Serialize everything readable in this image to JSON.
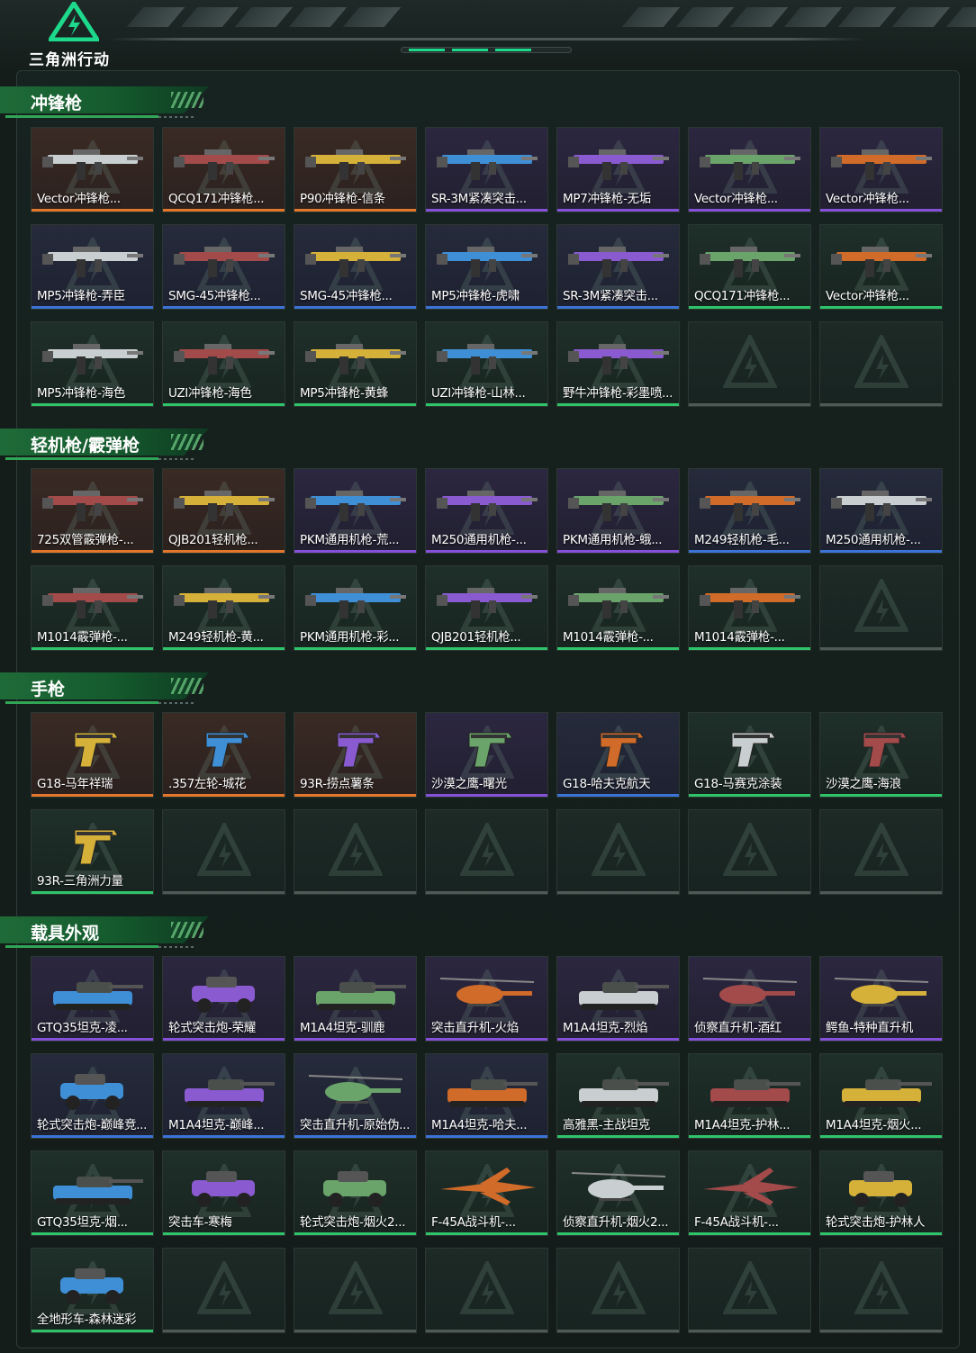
{
  "header": {
    "logo_text": "三角洲行动"
  },
  "colors": {
    "accent": "#1dd98c",
    "orange": "#e2772b",
    "purple": "#8551d8",
    "blue": "#3c73d6",
    "green": "#2fc46a"
  },
  "sections": [
    {
      "title": "冲锋枪",
      "icon": "smg",
      "items": [
        {
          "label": "Vector冲锋枪...",
          "rarity": "orange"
        },
        {
          "label": "QCQ171冲锋枪...",
          "rarity": "orange"
        },
        {
          "label": "P90冲锋枪-信条",
          "rarity": "orange"
        },
        {
          "label": "SR-3M紧凑突击...",
          "rarity": "purple"
        },
        {
          "label": "MP7冲锋枪-无垢",
          "rarity": "purple"
        },
        {
          "label": "Vector冲锋枪...",
          "rarity": "purple"
        },
        {
          "label": "Vector冲锋枪...",
          "rarity": "purple"
        },
        {
          "label": "MP5冲锋枪-弄臣",
          "rarity": "blue"
        },
        {
          "label": "SMG-45冲锋枪...",
          "rarity": "blue"
        },
        {
          "label": "SMG-45冲锋枪...",
          "rarity": "blue"
        },
        {
          "label": "MP5冲锋枪-虎啸",
          "rarity": "blue"
        },
        {
          "label": "SR-3M紧凑突击...",
          "rarity": "blue"
        },
        {
          "label": "QCQ171冲锋枪...",
          "rarity": "green"
        },
        {
          "label": "Vector冲锋枪...",
          "rarity": "green"
        },
        {
          "label": "MP5冲锋枪-海色",
          "rarity": "green"
        },
        {
          "label": "UZI冲锋枪-海色",
          "rarity": "green"
        },
        {
          "label": "MP5冲锋枪-黄蜂",
          "rarity": "green"
        },
        {
          "label": "UZI冲锋枪-山林...",
          "rarity": "green"
        },
        {
          "label": "野牛冲锋枪-彩墨喷...",
          "rarity": "green"
        },
        {
          "label": "",
          "rarity": "empty"
        },
        {
          "label": "",
          "rarity": "empty"
        }
      ]
    },
    {
      "title": "轻机枪/霰弹枪",
      "icon": "lmg",
      "items": [
        {
          "label": "725双管霰弹枪-...",
          "rarity": "orange"
        },
        {
          "label": "QJB201轻机枪...",
          "rarity": "orange"
        },
        {
          "label": "PKM通用机枪-荒...",
          "rarity": "purple"
        },
        {
          "label": "M250通用机枪-...",
          "rarity": "purple"
        },
        {
          "label": "PKM通用机枪-蛾...",
          "rarity": "purple"
        },
        {
          "label": "M249轻机枪-毛...",
          "rarity": "blue"
        },
        {
          "label": "M250通用机枪-...",
          "rarity": "blue"
        },
        {
          "label": "M1014霰弹枪-...",
          "rarity": "green"
        },
        {
          "label": "M249轻机枪-黄...",
          "rarity": "green"
        },
        {
          "label": "PKM通用机枪-彩...",
          "rarity": "green"
        },
        {
          "label": "QJB201轻机枪...",
          "rarity": "green"
        },
        {
          "label": "M1014霰弹枪-...",
          "rarity": "green"
        },
        {
          "label": "M1014霰弹枪-...",
          "rarity": "green"
        },
        {
          "label": "",
          "rarity": "empty"
        }
      ]
    },
    {
      "title": "手枪",
      "icon": "pistol",
      "items": [
        {
          "label": "G18-马年祥瑞",
          "rarity": "orange"
        },
        {
          "label": ".357左轮-城花",
          "rarity": "orange"
        },
        {
          "label": "93R-捞点薯条",
          "rarity": "orange"
        },
        {
          "label": "沙漠之鹰-曙光",
          "rarity": "purple"
        },
        {
          "label": "G18-哈夫克航天",
          "rarity": "blue"
        },
        {
          "label": "G18-马赛克涂装",
          "rarity": "green"
        },
        {
          "label": "沙漠之鹰-海浪",
          "rarity": "green"
        },
        {
          "label": "93R-三角洲力量",
          "rarity": "green"
        },
        {
          "label": "",
          "rarity": "empty"
        },
        {
          "label": "",
          "rarity": "empty"
        },
        {
          "label": "",
          "rarity": "empty"
        },
        {
          "label": "",
          "rarity": "empty"
        },
        {
          "label": "",
          "rarity": "empty"
        },
        {
          "label": "",
          "rarity": "empty"
        }
      ]
    },
    {
      "title": "载具外观",
      "icon": "vehicle",
      "items": [
        {
          "label": "GTQ35坦克-凌...",
          "rarity": "purple",
          "kind": "tank"
        },
        {
          "label": "轮式突击炮-荣耀",
          "rarity": "purple",
          "kind": "car"
        },
        {
          "label": "M1A4坦克-驯鹿",
          "rarity": "purple",
          "kind": "tank"
        },
        {
          "label": "突击直升机-火焰",
          "rarity": "purple",
          "kind": "heli"
        },
        {
          "label": "M1A4坦克-烈焰",
          "rarity": "purple",
          "kind": "tank"
        },
        {
          "label": "侦察直升机-酒红",
          "rarity": "purple",
          "kind": "heli"
        },
        {
          "label": "鳄鱼-特种直升机",
          "rarity": "purple",
          "kind": "heli"
        },
        {
          "label": "轮式突击炮-巅峰竞...",
          "rarity": "blue",
          "kind": "car"
        },
        {
          "label": "M1A4坦克-巅峰...",
          "rarity": "blue",
          "kind": "tank"
        },
        {
          "label": "突击直升机-原始伪...",
          "rarity": "blue",
          "kind": "heli"
        },
        {
          "label": "M1A4坦克-哈夫...",
          "rarity": "blue",
          "kind": "tank"
        },
        {
          "label": "高雅黑-主战坦克",
          "rarity": "green",
          "kind": "tank"
        },
        {
          "label": "M1A4坦克-护林...",
          "rarity": "green",
          "kind": "tank"
        },
        {
          "label": "M1A4坦克-烟火...",
          "rarity": "green",
          "kind": "tank"
        },
        {
          "label": "GTQ35坦克-烟...",
          "rarity": "green",
          "kind": "tank"
        },
        {
          "label": "突击车-寒梅",
          "rarity": "green",
          "kind": "car"
        },
        {
          "label": "轮式突击炮-烟火2...",
          "rarity": "green",
          "kind": "car"
        },
        {
          "label": "F-45A战斗机-...",
          "rarity": "green",
          "kind": "jet"
        },
        {
          "label": "侦察直升机-烟火2...",
          "rarity": "green",
          "kind": "heli"
        },
        {
          "label": "F-45A战斗机-...",
          "rarity": "green",
          "kind": "jet"
        },
        {
          "label": "轮式突击炮-护林人",
          "rarity": "green",
          "kind": "car"
        },
        {
          "label": "全地形车-森林迷彩",
          "rarity": "green",
          "kind": "atv"
        },
        {
          "label": "",
          "rarity": "empty"
        },
        {
          "label": "",
          "rarity": "empty"
        },
        {
          "label": "",
          "rarity": "empty"
        },
        {
          "label": "",
          "rarity": "empty"
        },
        {
          "label": "",
          "rarity": "empty"
        },
        {
          "label": "",
          "rarity": "empty"
        }
      ]
    }
  ]
}
